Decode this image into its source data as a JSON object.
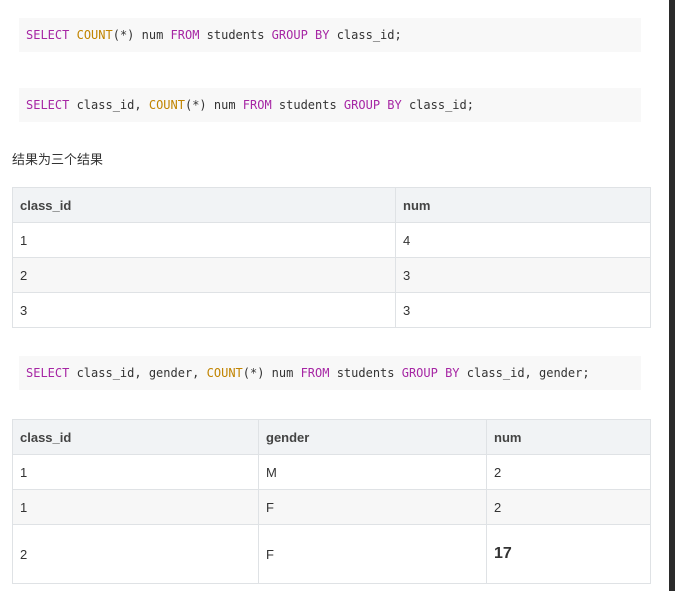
{
  "code_blocks": [
    [
      {
        "t": "SELECT",
        "c": "kw"
      },
      {
        "t": " ",
        "c": ""
      },
      {
        "t": "COUNT",
        "c": "fn"
      },
      {
        "t": "(*) num ",
        "c": ""
      },
      {
        "t": "FROM",
        "c": "kw"
      },
      {
        "t": " students ",
        "c": ""
      },
      {
        "t": "GROUP",
        "c": "kw"
      },
      {
        "t": " ",
        "c": ""
      },
      {
        "t": "BY",
        "c": "kw"
      },
      {
        "t": " class_id;",
        "c": ""
      }
    ],
    [
      {
        "t": "SELECT",
        "c": "kw"
      },
      {
        "t": " class_id, ",
        "c": ""
      },
      {
        "t": "COUNT",
        "c": "fn"
      },
      {
        "t": "(*) num ",
        "c": ""
      },
      {
        "t": "FROM",
        "c": "kw"
      },
      {
        "t": " students ",
        "c": ""
      },
      {
        "t": "GROUP",
        "c": "kw"
      },
      {
        "t": " ",
        "c": ""
      },
      {
        "t": "BY",
        "c": "kw"
      },
      {
        "t": " class_id;",
        "c": ""
      }
    ],
    [
      {
        "t": "SELECT",
        "c": "kw"
      },
      {
        "t": " class_id, gender, ",
        "c": ""
      },
      {
        "t": "COUNT",
        "c": "fn"
      },
      {
        "t": "(*) num ",
        "c": ""
      },
      {
        "t": "FROM",
        "c": "kw"
      },
      {
        "t": " students ",
        "c": ""
      },
      {
        "t": "GROUP",
        "c": "kw"
      },
      {
        "t": " ",
        "c": ""
      },
      {
        "t": "BY",
        "c": "kw"
      },
      {
        "t": " class_id, gender;",
        "c": ""
      }
    ]
  ],
  "paragraph": "结果为三个结果",
  "table1": {
    "headers": [
      "class_id",
      "num"
    ],
    "rows": [
      [
        "1",
        "4"
      ],
      [
        "2",
        "3"
      ],
      [
        "3",
        "3"
      ]
    ]
  },
  "table2": {
    "headers": [
      "class_id",
      "gender",
      "num"
    ],
    "rows": [
      [
        "1",
        "M",
        "2"
      ],
      [
        "1",
        "F",
        "2"
      ],
      [
        "2",
        "F",
        "17"
      ]
    ]
  },
  "colors": {
    "keyword": "#a626a4",
    "function": "#c18401",
    "code_background": "#f8f8f8",
    "table_header_background": "#f1f3f5",
    "table_border": "#dfe2e5"
  }
}
